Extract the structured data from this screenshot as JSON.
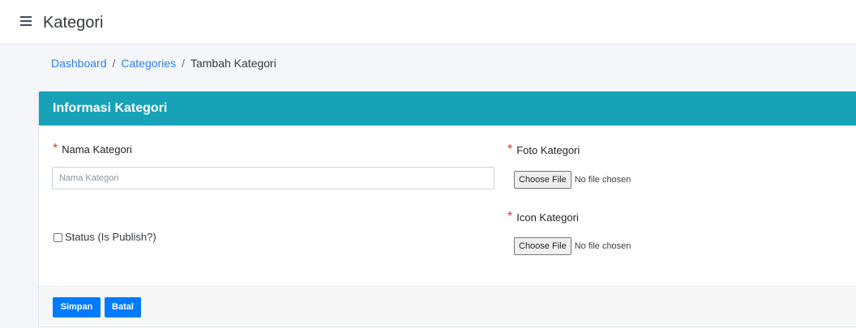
{
  "header": {
    "title": "Kategori",
    "menu_icon": "hamburger-menu-icon"
  },
  "breadcrumb": {
    "items": [
      "Dashboard",
      "Categories",
      "Tambah Kategori"
    ],
    "separator": "/"
  },
  "card": {
    "title": "Informasi Kategori",
    "header_color": "#17a2b8",
    "required_marker": "*",
    "nama_kategori": {
      "label": "Nama Kategori",
      "placeholder": "Nama Kategori",
      "value": ""
    },
    "status": {
      "label": "Status (Is Publish?)",
      "checked": false
    },
    "foto_kategori": {
      "label": "Foto Kategori",
      "button_label": "Choose File",
      "status_text": "No file chosen"
    },
    "icon_kategori": {
      "label": "Icon Kategori",
      "button_label": "Choose File",
      "status_text": "No file chosen"
    }
  },
  "footer": {
    "save_label": "Simpan",
    "cancel_label": "Batal",
    "button_color": "#007bff"
  }
}
